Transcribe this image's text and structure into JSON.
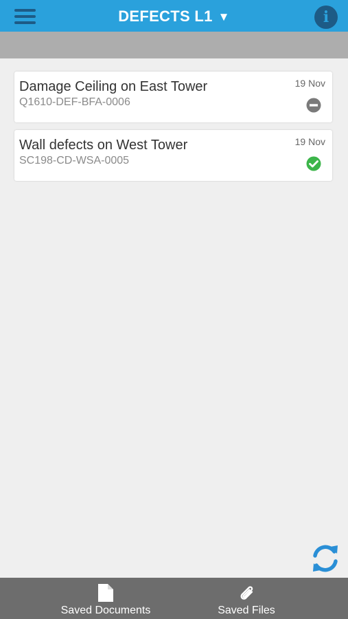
{
  "header": {
    "title": "DEFECTS L1",
    "caret": "▼",
    "menu_icon": "hamburger-menu-icon",
    "info_icon": "info-icon",
    "info_glyph": "i",
    "colors": {
      "topbar": "#2aa1dc",
      "icon": "#1d5b86",
      "subbar": "#adadad"
    }
  },
  "defects": [
    {
      "title": "Damage Ceiling on East Tower",
      "code": "Q1610-DEF-BFA-0006",
      "date": "19 Nov",
      "status_icon": "minus-circle-icon",
      "status_color": "#7a7a7a"
    },
    {
      "title": "Wall defects on West Tower",
      "code": "SC198-CD-WSA-0005",
      "date": "19 Nov",
      "status_icon": "check-circle-icon",
      "status_color": "#3cb54a"
    }
  ],
  "sync": {
    "icon": "sync-icon",
    "color": "#2a8fd6"
  },
  "bottom_nav": {
    "saved_documents": {
      "label": "Saved Documents",
      "icon": "document-icon"
    },
    "saved_files": {
      "label": "Saved Files",
      "icon": "paperclip-icon"
    },
    "background": "#6d6d6d"
  }
}
